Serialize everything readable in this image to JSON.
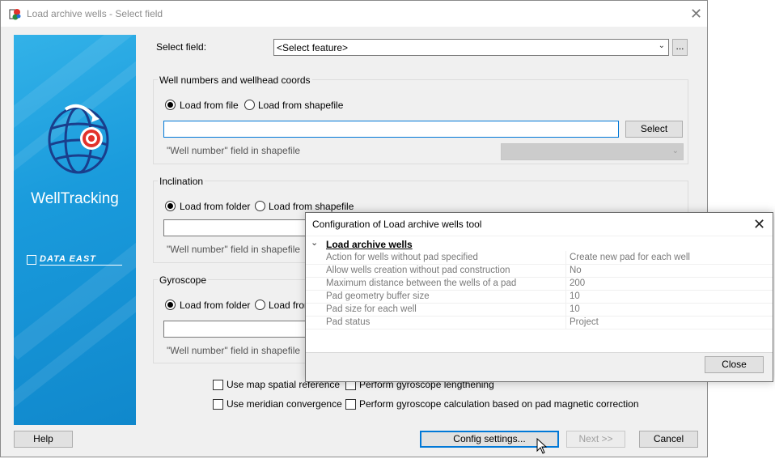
{
  "main_window": {
    "title": "Load archive wells - Select field",
    "close_icon": "close-icon"
  },
  "sidebar": {
    "brand": "WellTracking",
    "company": "DATA EAST",
    "logo_icon": "globe-target-icon"
  },
  "select_field": {
    "label": "Select field:",
    "value": "<Select feature>",
    "browse_label": "..."
  },
  "well_numbers": {
    "group_title": "Well numbers and wellhead coords",
    "radio_file": "Load from file",
    "radio_shapefile": "Load from shapefile",
    "selected": "file",
    "path_value": "",
    "select_button": "Select",
    "field_label": "\"Well number\" field in shapefile"
  },
  "inclination": {
    "group_title": "Inclination",
    "radio_folder": "Load from folder",
    "radio_shapefile": "Load from shapefile",
    "selected": "folder",
    "field_label": "\"Well number\" field in shapefile"
  },
  "gyroscope": {
    "group_title": "Gyroscope",
    "radio_folder": "Load from folder",
    "radio_shapefile": "Load from",
    "selected": "folder",
    "field_label": "\"Well number\" field in shapefile"
  },
  "options": {
    "use_map_spatial_reference": "Use map spatial reference",
    "perform_gyroscope_lengthening": "Perform gyroscope lengthening",
    "use_meridian_convergence": "Use meridian convergence",
    "perform_gyroscope_calculation": "Perform gyroscope calculation based on pad magnetic correction"
  },
  "footer": {
    "help": "Help",
    "config_settings": "Config settings...",
    "next": "Next >>",
    "cancel": "Cancel"
  },
  "config_dialog": {
    "title": "Configuration of Load archive wells tool",
    "category": "Load archive wells",
    "rows": [
      {
        "key": "Action for wells without pad specified",
        "value": "Create new pad for each well"
      },
      {
        "key": "Allow wells creation without pad construction",
        "value": "No"
      },
      {
        "key": "Maximum distance between the wells of a pad",
        "value": "200"
      },
      {
        "key": "Pad geometry buffer size",
        "value": "10"
      },
      {
        "key": "Pad size for each well",
        "value": "10"
      },
      {
        "key": "Pad status",
        "value": "Project"
      }
    ],
    "close_button": "Close"
  }
}
